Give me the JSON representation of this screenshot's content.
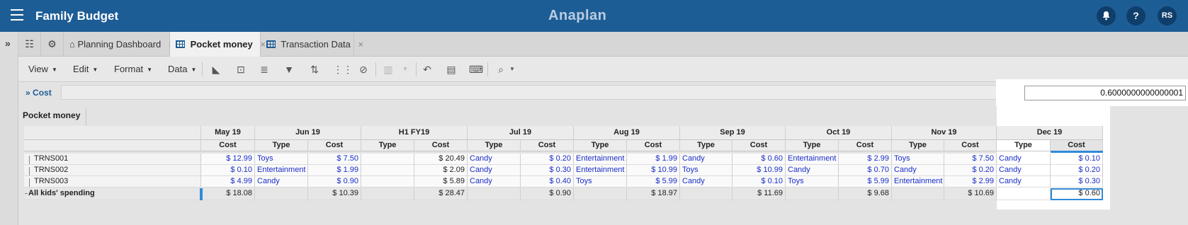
{
  "header": {
    "app_title": "Family Budget",
    "brand": "Anaplan",
    "avatar_initials": "RS",
    "bell_icon": "bell-icon",
    "help_icon": "?",
    "accent_color": "#1d5d95"
  },
  "rail": {
    "toggle": "»"
  },
  "tabs": [
    {
      "label": "Planning Dashboard",
      "icon": "house-icon",
      "close": "×"
    },
    {
      "label": "Pocket money",
      "icon": "grid-icon",
      "close": "×",
      "active": true
    },
    {
      "label": "Transaction Data",
      "icon": "grid-icon",
      "close": "×"
    }
  ],
  "toolbar": {
    "menus": [
      "View",
      "Edit",
      "Format",
      "Data"
    ]
  },
  "formula": {
    "name": "Cost",
    "value": "0.6000000000000001"
  },
  "module": {
    "title": "Pocket money"
  },
  "grid": {
    "periods": [
      "May 19",
      "Jun 19",
      "H1 FY19",
      "Jul 19",
      "Aug 19",
      "Sep 19",
      "Oct 19",
      "Nov 19",
      "Dec 19"
    ],
    "sub_type": "Type",
    "sub_cost": "Cost",
    "rows": [
      {
        "label": "TRNS001",
        "may_cost": "$ 12.99",
        "jun_type": "Toys",
        "jun_cost": "$ 7.50",
        "h1_type": "",
        "h1_cost": "$ 20.49",
        "jul_type": "Candy",
        "jul_cost": "$ 0.20",
        "aug_type": "Entertainment",
        "aug_cost": "$ 1.99",
        "sep_type": "Candy",
        "sep_cost": "$ 0.60",
        "oct_type": "Entertainment",
        "oct_cost": "$ 2.99",
        "nov_type": "Toys",
        "nov_cost": "$ 7.50",
        "dec_type": "Candy",
        "dec_cost": "$ 0.10"
      },
      {
        "label": "TRNS002",
        "may_cost": "$ 0.10",
        "jun_type": "Entertainment",
        "jun_cost": "$ 1.99",
        "h1_type": "",
        "h1_cost": "$ 2.09",
        "jul_type": "Candy",
        "jul_cost": "$ 0.30",
        "aug_type": "Entertainment",
        "aug_cost": "$ 10.99",
        "sep_type": "Toys",
        "sep_cost": "$ 10.99",
        "oct_type": "Candy",
        "oct_cost": "$ 0.70",
        "nov_type": "Candy",
        "nov_cost": "$ 0.20",
        "dec_type": "Candy",
        "dec_cost": "$ 0.20"
      },
      {
        "label": "TRNS003",
        "may_cost": "$ 4.99",
        "jun_type": "Candy",
        "jun_cost": "$ 0.90",
        "h1_type": "",
        "h1_cost": "$ 5.89",
        "jul_type": "Candy",
        "jul_cost": "$ 0.40",
        "aug_type": "Toys",
        "aug_cost": "$ 5.99",
        "sep_type": "Candy",
        "sep_cost": "$ 0.10",
        "oct_type": "Toys",
        "oct_cost": "$ 5.99",
        "nov_type": "Entertainment",
        "nov_cost": "$ 2.99",
        "dec_type": "Candy",
        "dec_cost": "$ 0.30"
      }
    ],
    "total": {
      "label": "All kids' spending",
      "may_cost": "$ 18.08",
      "jun_cost": "$ 10.39",
      "h1_cost": "$ 28.47",
      "jul_cost": "$ 0.90",
      "aug_cost": "$ 18.97",
      "sep_cost": "$ 11.69",
      "oct_cost": "$ 9.68",
      "nov_cost": "$ 10.69",
      "dec_cost": "$ 0.60"
    }
  }
}
